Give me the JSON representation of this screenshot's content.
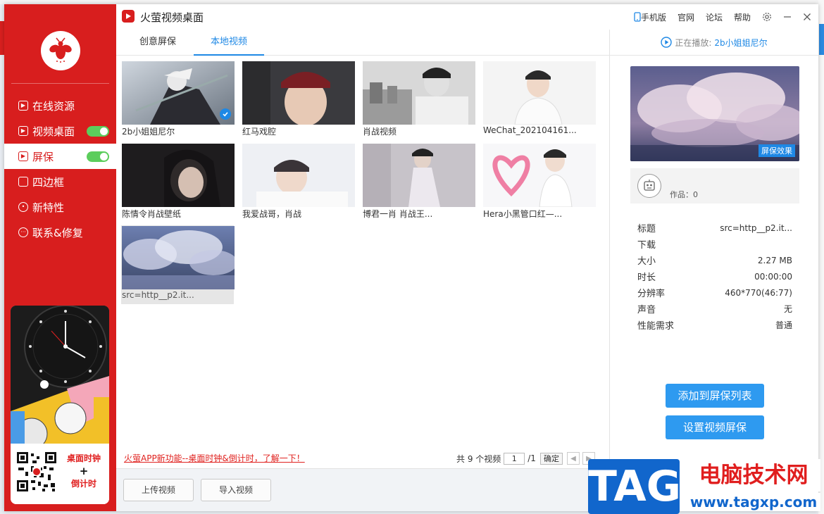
{
  "app": {
    "title": "火萤视频桌面"
  },
  "titlebar": {
    "mobile": "手机版",
    "official": "官网",
    "forum": "论坛",
    "help": "帮助"
  },
  "sidebar": {
    "items": [
      {
        "label": "在线资源",
        "toggle": false,
        "active": false
      },
      {
        "label": "视频桌面",
        "toggle": true,
        "active": false
      },
      {
        "label": "屏保",
        "toggle": true,
        "active": true
      },
      {
        "label": "四边框",
        "toggle": false,
        "active": false
      },
      {
        "label": "新特性",
        "toggle": false,
        "active": false
      },
      {
        "label": "联系&修复",
        "toggle": false,
        "active": false
      }
    ],
    "promo": {
      "line1": "桌面时钟",
      "plus": "+",
      "line2": "倒计时"
    }
  },
  "tabs": [
    {
      "label": "创意屏保",
      "active": false
    },
    {
      "label": "本地视频",
      "active": true
    }
  ],
  "videos": [
    {
      "caption": "2b小姐姐尼尔",
      "selected": true
    },
    {
      "caption": "红马戏腔",
      "selected": false
    },
    {
      "caption": "肖战视频",
      "selected": false
    },
    {
      "caption": "WeChat_202104161...",
      "selected": false
    },
    {
      "caption": "陈情令肖战壁纸",
      "selected": false
    },
    {
      "caption": "我爱战哥，肖战",
      "selected": false
    },
    {
      "caption": "博君一肖 肖战王...",
      "selected": false
    },
    {
      "caption": "Hera小黑管口红—...",
      "selected": false
    },
    {
      "caption": "src=http__p2.it...",
      "selected": false
    }
  ],
  "list_footer": {
    "news": "火萤APP新功能--桌面时钟&倒计时，了解一下！",
    "total": "共 9 个视频",
    "page": "1",
    "pages": "/1",
    "confirm": "确定"
  },
  "bottom_buttons": {
    "upload": "上传视频",
    "import": "导入视频"
  },
  "right_panel": {
    "now_playing_label": "正在播放:",
    "now_playing_title": "2b小姐姐尼尔",
    "preview_badge": "屏保效果",
    "works": "作品：0",
    "info": [
      {
        "label": "标题",
        "value": "src=http__p2.it..."
      },
      {
        "label": "下载",
        "value": ""
      },
      {
        "label": "大小",
        "value": "2.27 MB"
      },
      {
        "label": "时长",
        "value": "00:00:00"
      },
      {
        "label": "分辨率",
        "value": "460*770(46:77)"
      },
      {
        "label": "声音",
        "value": "无"
      },
      {
        "label": "性能需求",
        "value": "普通"
      }
    ],
    "add_button": "添加到屏保列表",
    "set_button": "设置视频屏保"
  },
  "watermark": {
    "tag": "TAG",
    "cn": "电脑技术网",
    "url": "www.tagxp.com"
  },
  "colors": {
    "brand_red": "#d81e1e",
    "accent_blue": "#1e88e5",
    "toggle_green": "#5ccd5c"
  }
}
